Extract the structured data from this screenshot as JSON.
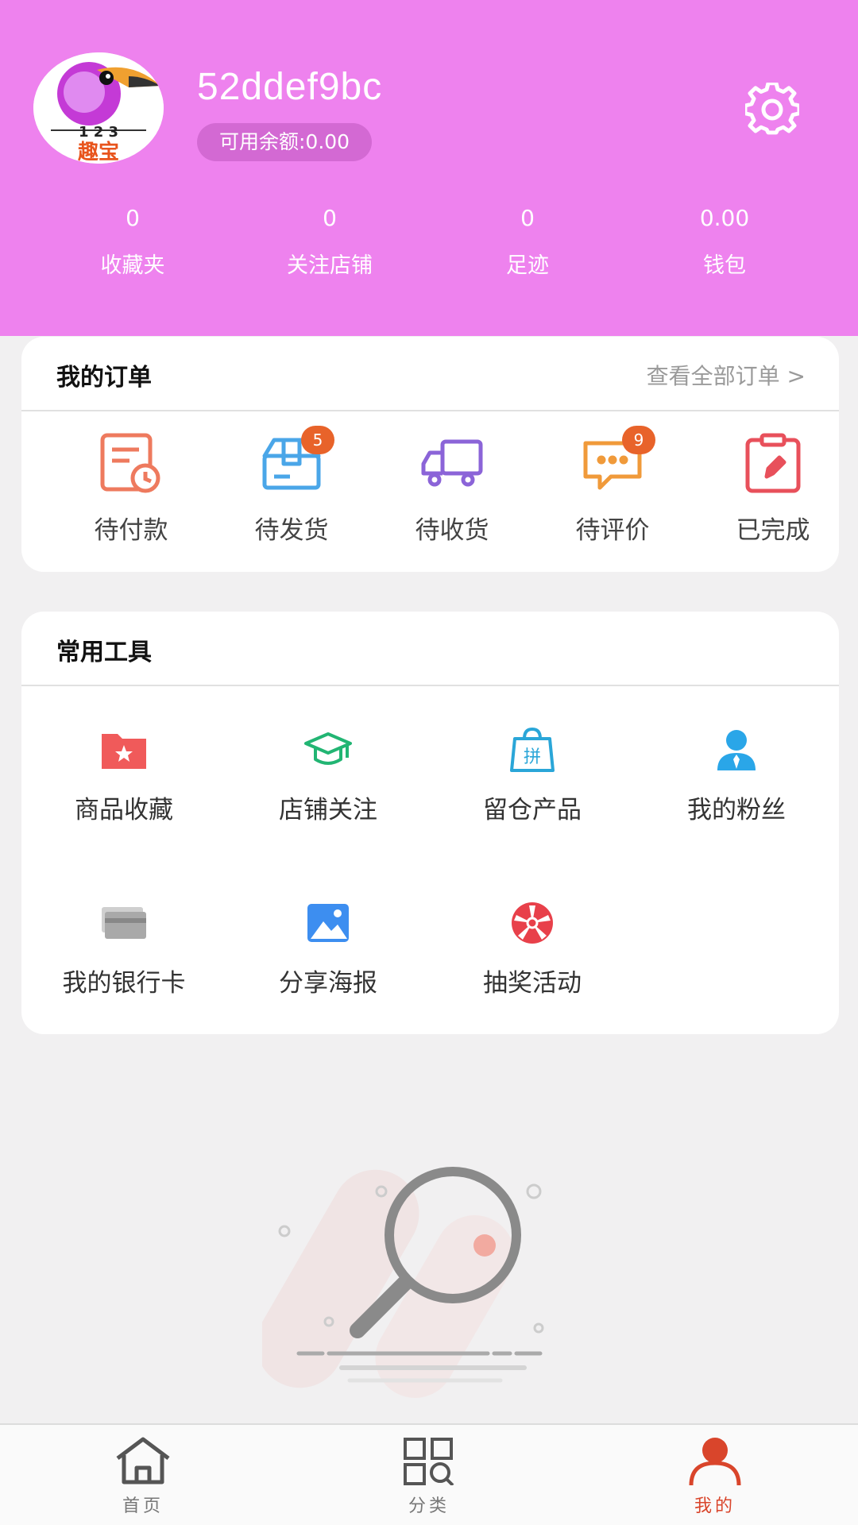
{
  "profile": {
    "username": "52ddef9bc",
    "balance_label": "可用余额:0.00",
    "avatar_text_top": "1 2 3",
    "avatar_text_bottom": "趣宝"
  },
  "stats": [
    {
      "value": "0",
      "label": "收藏夹"
    },
    {
      "value": "0",
      "label": "关注店铺"
    },
    {
      "value": "0",
      "label": "足迹"
    },
    {
      "value": "0.00",
      "label": "钱包"
    }
  ],
  "orders": {
    "title": "我的订单",
    "view_all": "查看全部订单 >",
    "items": [
      {
        "label": "待付款",
        "icon": "pending-payment-icon",
        "badge": ""
      },
      {
        "label": "待发货",
        "icon": "pending-shipment-icon",
        "badge": "5"
      },
      {
        "label": "待收货",
        "icon": "delivery-truck-icon",
        "badge": ""
      },
      {
        "label": "待评价",
        "icon": "review-chat-icon",
        "badge": "9"
      },
      {
        "label": "已完成",
        "icon": "completed-clipboard-icon",
        "badge": ""
      }
    ]
  },
  "tools": {
    "title": "常用工具",
    "items": [
      {
        "label": "商品收藏",
        "icon": "favorite-folder-icon"
      },
      {
        "label": "店铺关注",
        "icon": "graduation-cap-icon"
      },
      {
        "label": "留仓产品",
        "icon": "shopping-bag-icon"
      },
      {
        "label": "我的粉丝",
        "icon": "fans-user-icon"
      },
      {
        "label": "我的银行卡",
        "icon": "bank-card-icon"
      },
      {
        "label": "分享海报",
        "icon": "poster-image-icon"
      },
      {
        "label": "抽奖活动",
        "icon": "lottery-wheel-icon"
      }
    ]
  },
  "tabbar": [
    {
      "label": "首页",
      "icon": "home-icon"
    },
    {
      "label": "分类",
      "icon": "category-icon"
    },
    {
      "label": "我的",
      "icon": "profile-icon"
    }
  ],
  "colors": {
    "header_bg": "#ee82ee",
    "badge": "#e8632a",
    "active_tab": "#d9452b"
  }
}
